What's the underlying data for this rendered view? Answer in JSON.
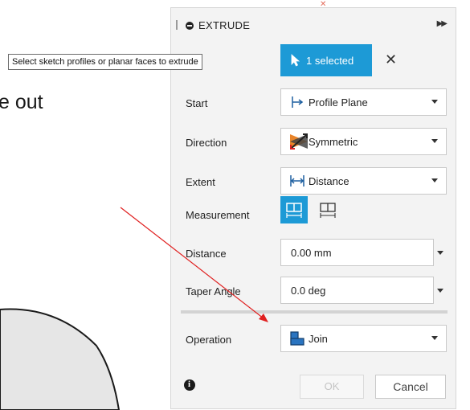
{
  "background": {
    "partial_text": "e out"
  },
  "panel": {
    "title": "EXTRUDE",
    "profiles": {
      "selected_label": "1 selected"
    },
    "rows": {
      "start": {
        "label": "Start",
        "value": "Profile Plane"
      },
      "direction": {
        "label": "Direction",
        "value": "Symmetric"
      },
      "extent": {
        "label": "Extent",
        "value": "Distance"
      },
      "measurement": {
        "label": "Measurement"
      },
      "distance": {
        "label": "Distance",
        "value": "0.00 mm"
      },
      "taper": {
        "label": "Taper Angle",
        "value": "0.0 deg"
      },
      "operation": {
        "label": "Operation",
        "value": "Join"
      }
    },
    "buttons": {
      "ok": "OK",
      "cancel": "Cancel"
    }
  },
  "tooltip": {
    "text": "Select sketch profiles or planar faces to extrude"
  },
  "colors": {
    "accent": "#1d9ad6",
    "arrow": "#e02020"
  },
  "icons": {
    "title": "circle-minus-icon",
    "expand": "double-chevron-right-icon",
    "selected": "cursor-arrow-icon",
    "clear": "close-icon",
    "start": "profile-plane-icon",
    "direction": "symmetric-icon",
    "extent": "distance-icon",
    "measurement_1": "measure-symmetric-icon",
    "measurement_2": "measure-one-side-icon",
    "operation": "join-icon",
    "info": "info-icon"
  }
}
